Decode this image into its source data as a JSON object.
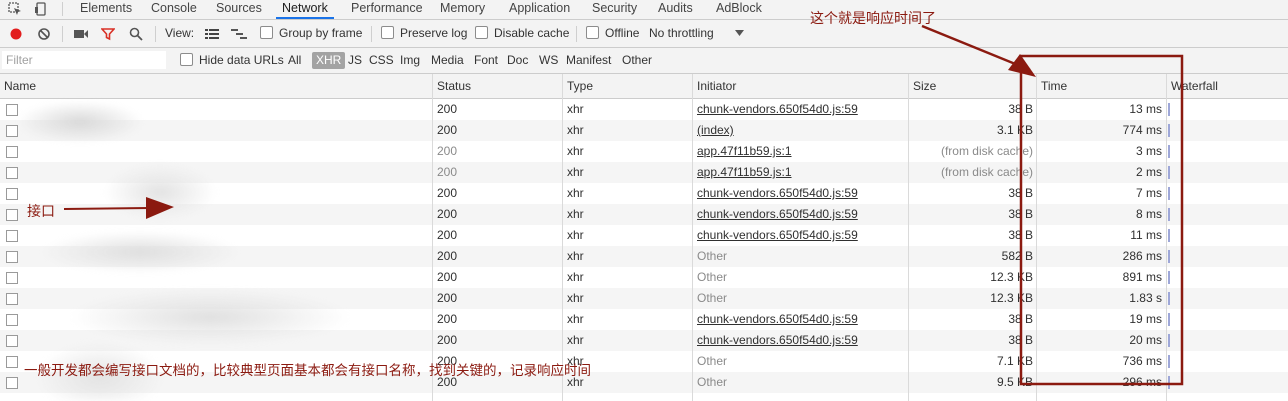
{
  "devtools_tabs": [
    "Elements",
    "Console",
    "Sources",
    "Network",
    "Performance",
    "Memory",
    "Application",
    "Security",
    "Audits",
    "AdBlock"
  ],
  "active_tab": "Network",
  "toolbar": {
    "view_label": "View:",
    "group_by_frame": "Group by frame",
    "preserve_log": "Preserve log",
    "disable_cache": "Disable cache",
    "offline": "Offline",
    "throttling": "No throttling"
  },
  "filter": {
    "placeholder": "Filter",
    "hide_data_urls": "Hide data URLs",
    "types": [
      "All",
      "XHR",
      "JS",
      "CSS",
      "Img",
      "Media",
      "Font",
      "Doc",
      "WS",
      "Manifest",
      "Other"
    ],
    "active_type": "XHR"
  },
  "columns": {
    "name": "Name",
    "status": "Status",
    "type": "Type",
    "initiator": "Initiator",
    "size": "Size",
    "time": "Time",
    "waterfall": "Waterfall"
  },
  "rows": [
    {
      "status": "200",
      "type": "xhr",
      "initiator": "chunk-vendors.650f54d0.js:59",
      "size": "38 B",
      "time": "13 ms"
    },
    {
      "status": "200",
      "type": "xhr",
      "initiator": "(index)",
      "size": "3.1 KB",
      "time": "774 ms"
    },
    {
      "status": "200",
      "type": "xhr",
      "initiator": "app.47f11b59.js:1",
      "size": "(from disk cache)",
      "time": "3 ms"
    },
    {
      "status": "200",
      "type": "xhr",
      "initiator": "app.47f11b59.js:1",
      "size": "(from disk cache)",
      "time": "2 ms"
    },
    {
      "status": "200",
      "type": "xhr",
      "initiator": "chunk-vendors.650f54d0.js:59",
      "size": "38 B",
      "time": "7 ms"
    },
    {
      "status": "200",
      "type": "xhr",
      "initiator": "chunk-vendors.650f54d0.js:59",
      "size": "38 B",
      "time": "8 ms"
    },
    {
      "status": "200",
      "type": "xhr",
      "initiator": "chunk-vendors.650f54d0.js:59",
      "size": "38 B",
      "time": "11 ms"
    },
    {
      "status": "200",
      "type": "xhr",
      "initiator": "Other",
      "size": "582 B",
      "time": "286 ms"
    },
    {
      "status": "200",
      "type": "xhr",
      "initiator": "Other",
      "size": "12.3 KB",
      "time": "891 ms"
    },
    {
      "status": "200",
      "type": "xhr",
      "initiator": "Other",
      "size": "12.3 KB",
      "time": "1.83 s"
    },
    {
      "status": "200",
      "type": "xhr",
      "initiator": "chunk-vendors.650f54d0.js:59",
      "size": "38 B",
      "time": "19 ms"
    },
    {
      "status": "200",
      "type": "xhr",
      "initiator": "chunk-vendors.650f54d0.js:59",
      "size": "38 B",
      "time": "20 ms"
    },
    {
      "status": "200",
      "type": "xhr",
      "initiator": "Other",
      "size": "7.1 KB",
      "time": "736 ms"
    },
    {
      "status": "200",
      "type": "xhr",
      "initiator": "Other",
      "size": "9.5 KB",
      "time": "296 ms"
    }
  ],
  "annotations": {
    "response_time": "这个就是响应时间了",
    "interface": "接口",
    "note": "一般开发都会编写接口文档的，比较典型页面基本都会有接口名称，找到关键的，记录响应时间"
  },
  "colors": {
    "annotation": "#8b1a10",
    "record_button": "#e21d1d",
    "filter_icon": "#d93025",
    "active_tab_underline": "#1a73e8"
  }
}
